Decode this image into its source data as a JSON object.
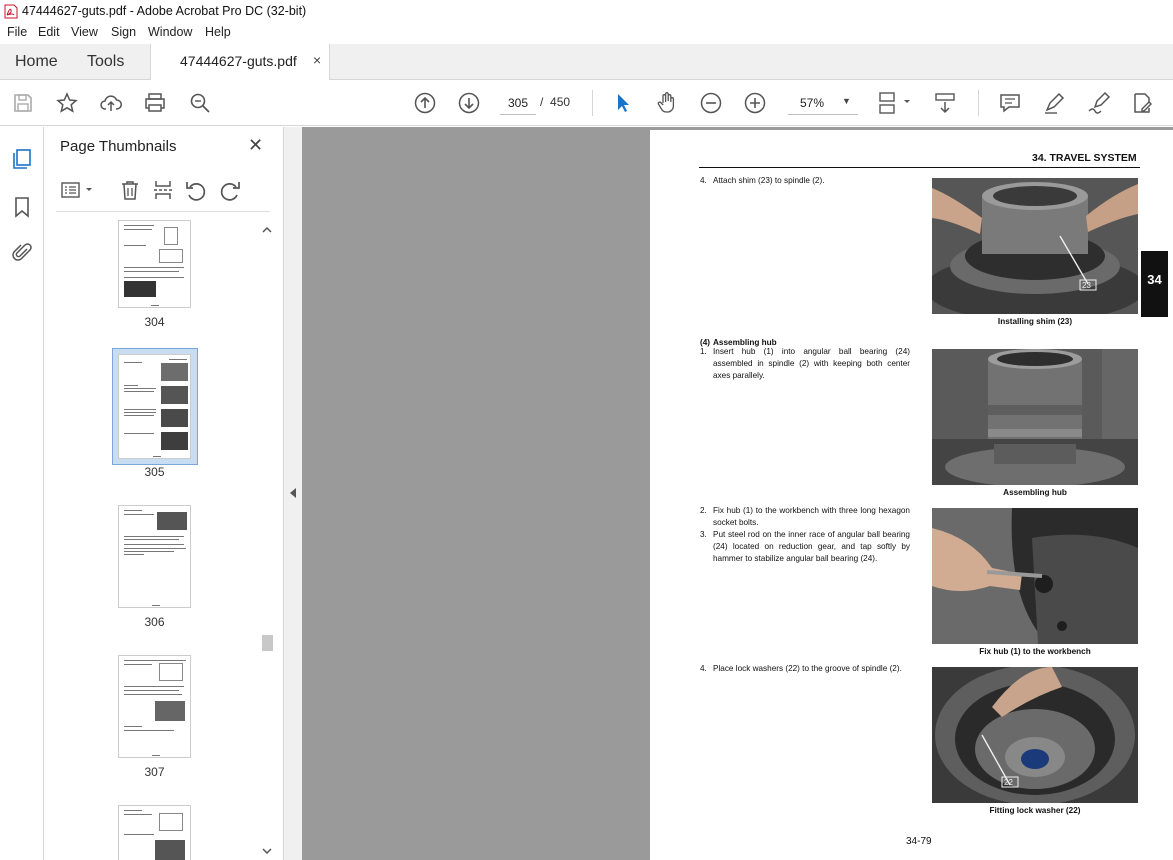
{
  "window": {
    "title": "47444627-guts.pdf - Adobe Acrobat Pro DC (32-bit)"
  },
  "menu": [
    "File",
    "Edit",
    "View",
    "Sign",
    "Window",
    "Help"
  ],
  "tabs": {
    "home": "Home",
    "tools": "Tools",
    "doc": "47444627-guts.pdf",
    "close": "×"
  },
  "toolbar": {
    "page_current": "305",
    "page_sep": "/",
    "page_total": "450",
    "zoom": "57%"
  },
  "thumbnails": {
    "title": "Page Thumbnails",
    "pages": [
      "304",
      "305",
      "306",
      "307"
    ]
  },
  "document": {
    "header": "34.  TRAVEL SYSTEM",
    "chapter_tab": "34",
    "footer": "34-79",
    "steps": [
      {
        "num": "4.",
        "text": "Attach shim (23) to spindle (2)."
      },
      {
        "num": "(4)",
        "text": "Assembling hub"
      },
      {
        "num": "1.",
        "text": "Insert hub (1) into angular ball bearing (24) assembled in spindle (2) with keeping both center axes parallely."
      },
      {
        "num": "2.",
        "text": "Fix hub (1) to the workbench with three long hexagon socket bolts."
      },
      {
        "num": "3.",
        "text": "Put steel rod on the inner race of angular ball bearing (24) located on reduction gear, and tap softly by hammer to stabilize angular ball bearing (24)."
      },
      {
        "num": "4.",
        "text": "Place lock washers (22) to the groove of spindle (2)."
      }
    ],
    "captions": [
      "Installing shim (23)",
      "Assembling hub",
      "Fix hub (1) to the workbench",
      "Fitting lock washer (22)"
    ],
    "callouts": [
      "23",
      "22"
    ]
  }
}
